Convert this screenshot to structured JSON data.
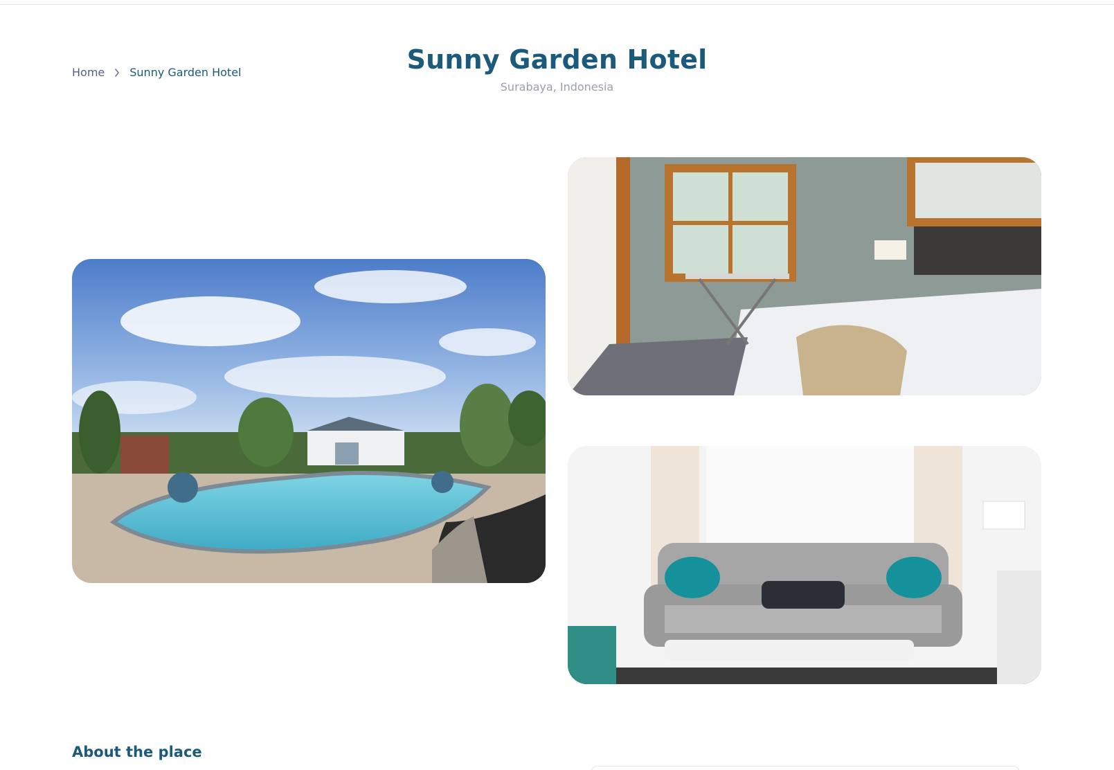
{
  "breadcrumb": {
    "home_label": "Home",
    "current_label": "Sunny Garden Hotel"
  },
  "hotel": {
    "title": "Sunny Garden Hotel",
    "location": "Surabaya, Indonesia"
  },
  "gallery": {
    "images": [
      {
        "name": "pool",
        "description": "Backyard pool with pool house"
      },
      {
        "name": "bedroom",
        "description": "Bedroom with white bed"
      },
      {
        "name": "living-room",
        "description": "Living room with grey sofa"
      }
    ]
  },
  "about": {
    "heading": "About the place"
  },
  "colors": {
    "primary": "#1b5a7a",
    "text": "#152c5b",
    "muted": "#9aa0ab",
    "border": "#e5e5e5"
  },
  "icons": {
    "breadcrumb_separator": "chevron-right-icon"
  }
}
